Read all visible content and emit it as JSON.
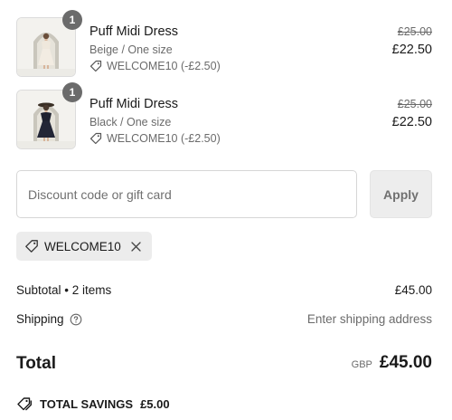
{
  "items": [
    {
      "quantity": "1",
      "title": "Puff Midi Dress",
      "variant": "Beige / One size",
      "discount": "WELCOME10 (-£2.50)",
      "original_price": "£25.00",
      "price": "£22.50",
      "image": "beige-dress-photo"
    },
    {
      "quantity": "1",
      "title": "Puff Midi Dress",
      "variant": "Black / One size",
      "discount": "WELCOME10 (-£2.50)",
      "original_price": "£25.00",
      "price": "£22.50",
      "image": "black-dress-photo"
    }
  ],
  "discount_form": {
    "placeholder": "Discount code or gift card",
    "value": "",
    "apply_label": "Apply"
  },
  "applied_code": {
    "code": "WELCOME10",
    "icon": "tag-icon",
    "remove_icon": "close-icon"
  },
  "summary": {
    "subtotal_label": "Subtotal • 2 items",
    "subtotal_value": "£45.00",
    "shipping_label": "Shipping",
    "shipping_value": "Enter shipping address",
    "total_label": "Total",
    "currency": "GBP",
    "total_value": "£45.00",
    "savings_label": "TOTAL SAVINGS",
    "savings_value": "£5.00"
  },
  "colors": {
    "badge": "#6b6b6b",
    "muted_text": "#6b6b6b",
    "chip_bg": "#ececec",
    "apply_bg": "#ededed"
  }
}
